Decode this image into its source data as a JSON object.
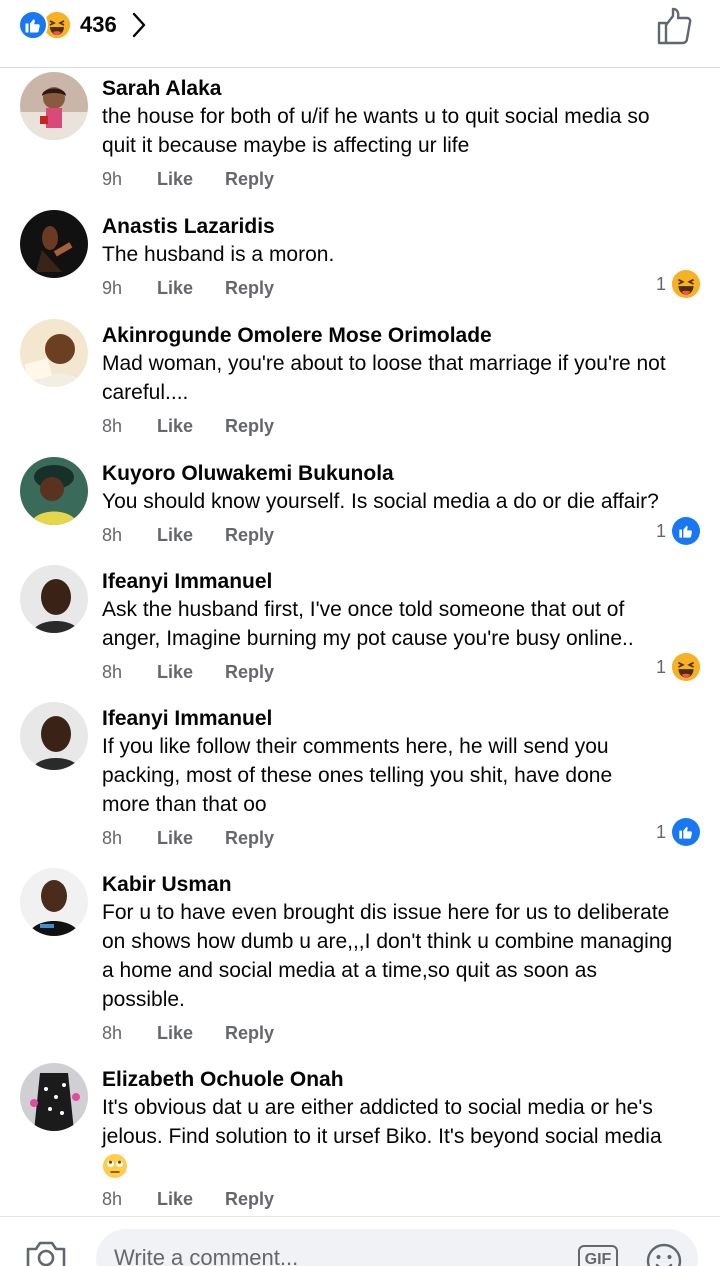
{
  "header": {
    "reaction_count": "436",
    "reaction_icons": [
      "like-icon",
      "haha-icon"
    ],
    "actions": [
      "chevron-right-icon",
      "thumbs-up-outline-icon"
    ]
  },
  "colors": {
    "like_blue": "#1877f2",
    "haha_yellow": "#f7b125",
    "meta_gray": "#65676b"
  },
  "comments": [
    {
      "name": "Sarah Alaka",
      "lines": [
        "the house for both of u/if he wants u to quit social media so",
        "quit it because maybe is affecting ur life"
      ],
      "time": "9h",
      "like": "Like",
      "reply": "Reply"
    },
    {
      "name": "Anastis Lazaridis",
      "lines": [
        "The husband is a moron."
      ],
      "time": "9h",
      "like": "Like",
      "reply": "Reply",
      "reaction": {
        "count": "1",
        "icon": "haha-icon"
      }
    },
    {
      "name": "Akinrogunde Omolere Mose Orimolade",
      "lines": [
        "Mad woman, you're about to loose that marriage if you're not",
        "careful...."
      ],
      "time": "8h",
      "like": "Like",
      "reply": "Reply"
    },
    {
      "name": "Kuyoro Oluwakemi Bukunola",
      "lines": [
        "You should know yourself. Is social media a do or die affair?"
      ],
      "time": "8h",
      "like": "Like",
      "reply": "Reply",
      "reaction": {
        "count": "1",
        "icon": "like-icon"
      }
    },
    {
      "name": "Ifeanyi Immanuel",
      "lines": [
        "Ask the husband first, I've once told someone that out of",
        "anger, Imagine burning my pot cause you're busy online.."
      ],
      "time": "8h",
      "like": "Like",
      "reply": "Reply",
      "reaction": {
        "count": "1",
        "icon": "haha-icon"
      }
    },
    {
      "name": "Ifeanyi Immanuel",
      "lines": [
        "If you like follow their comments here, he will send you",
        "packing, most of these ones telling you shit,   have done",
        "more than that oo"
      ],
      "time": "8h",
      "like": "Like",
      "reply": "Reply",
      "reaction": {
        "count": "1",
        "icon": "like-icon"
      }
    },
    {
      "name": "Kabir Usman",
      "lines": [
        "For u to have even brought dis issue here for us to deliberate",
        "on shows how dumb u are,,,I don't think u combine managing",
        "a home and social media at a time,so quit as soon as",
        "possible."
      ],
      "time": "8h",
      "like": "Like",
      "reply": "Reply"
    },
    {
      "name": "Elizabeth Ochuole Onah",
      "lines": [
        "It's obvious dat u are either addicted to social media or he's",
        "jelous. Find solution to it ursef Biko. It's beyond social media"
      ],
      "trailing_emoji": "face-with-rolling-eyes-icon",
      "time": "8h",
      "like": "Like",
      "reply": "Reply"
    }
  ],
  "composer": {
    "placeholder": "Write a comment...",
    "gif_label": "GIF",
    "icons": [
      "camera-icon",
      "emoji-icon"
    ]
  }
}
